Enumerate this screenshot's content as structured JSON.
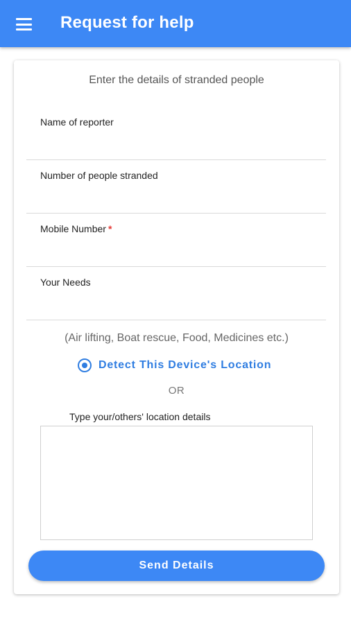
{
  "appbar": {
    "title": "Request for help",
    "menu_icon": "hamburger-menu-icon",
    "color": "#3d88f5"
  },
  "form": {
    "heading": "Enter the details of stranded people",
    "fields": [
      {
        "label": "Name of reporter",
        "value": "",
        "required": false
      },
      {
        "label": "Number of people stranded",
        "value": "",
        "required": false
      },
      {
        "label": "Mobile Number",
        "value": "",
        "required": true,
        "required_marker": "*"
      },
      {
        "label": "Your Needs",
        "value": "",
        "required": false
      }
    ],
    "needs_hint": "(Air lifting, Boat rescue, Food, Medicines etc.)",
    "detect_location": {
      "label": "Detect This Device's Location",
      "icon": "my-location-icon",
      "color": "#2f7de1"
    },
    "or_text": "OR",
    "location_details": {
      "label": "Type your/others' location details",
      "value": ""
    },
    "submit_label": "Send Details"
  }
}
